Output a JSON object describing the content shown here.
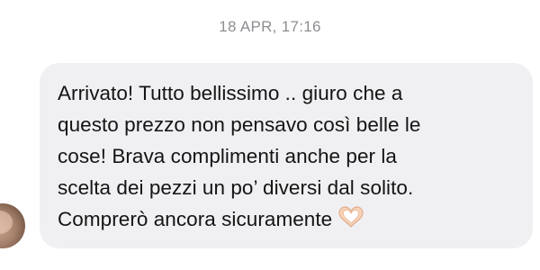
{
  "conversation": {
    "timestamp": "18 APR, 17:16",
    "message": {
      "lines": [
        "Arrivato! Tutto bellissimo .. giuro che a",
        "questo prezzo non pensavo così belle le",
        "cose! Brava complimenti anche per la",
        "scelta dei pezzi un po’ diversi dal solito.",
        "Comprerò ancora sicuramente"
      ],
      "emoji": "heart-hands-emoji"
    }
  }
}
